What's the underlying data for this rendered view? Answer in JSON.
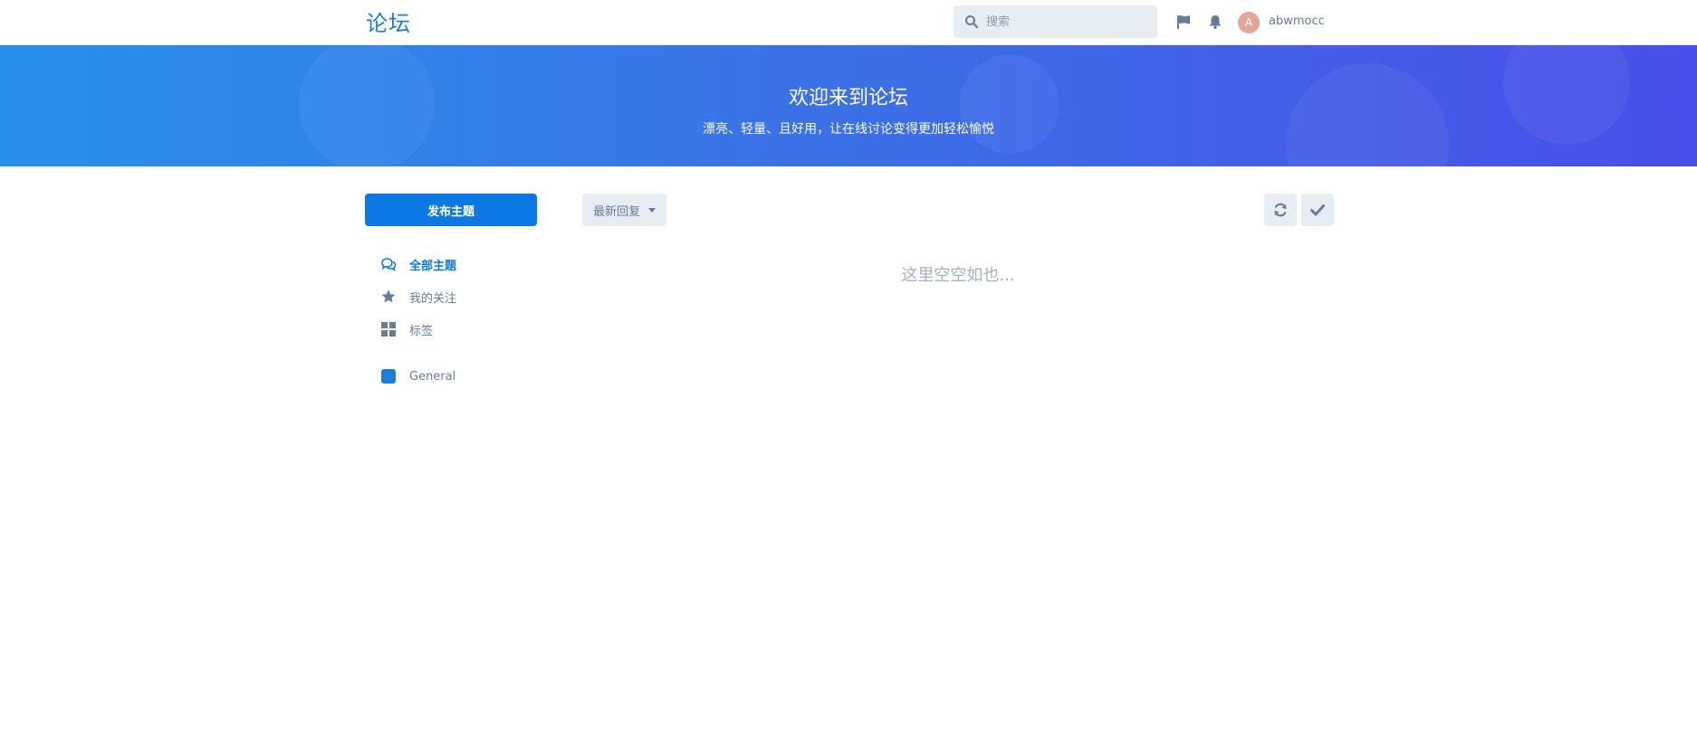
{
  "header": {
    "brand": "论坛",
    "search_placeholder": "搜索",
    "avatar_initial": "A",
    "username": "abwmocc"
  },
  "hero": {
    "title": "欢迎来到论坛",
    "subtitle": "漂亮、轻量、且好用，让在线讨论变得更加轻松愉悦"
  },
  "sidebar": {
    "start_discussion_label": "发布主题",
    "nav": [
      {
        "label": "全部主题",
        "icon": "comments-icon",
        "active": true
      },
      {
        "label": "我的关注",
        "icon": "star-icon",
        "active": false
      },
      {
        "label": "标签",
        "icon": "th-large-icon",
        "active": false
      }
    ],
    "tags": [
      {
        "label": "General",
        "color": "#1c7ed6",
        "icon": "tag-square-icon"
      }
    ]
  },
  "toolbar": {
    "sort_label": "最新回复",
    "refresh_icon": "refresh-icon",
    "mark_read_icon": "check-icon"
  },
  "main": {
    "empty_text": "这里空空如也..."
  },
  "colors": {
    "accent": "#0b78e3",
    "hero_gradient_start": "#2790ea",
    "hero_gradient_end": "#4a4ee8",
    "muted_text": "#667c99",
    "control_bg": "#e8ecf3"
  }
}
